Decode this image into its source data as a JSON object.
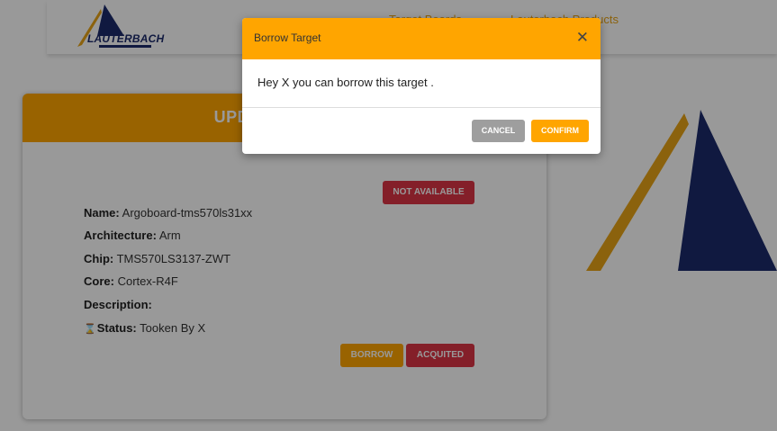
{
  "brand": {
    "name": "LAUTERBACH"
  },
  "nav": {
    "link1": "Target Boards",
    "link2": "Lauterbach Products"
  },
  "card": {
    "title": "UPDATE TARGET",
    "status_badge": "NOT AVAILABLE",
    "fields": {
      "name_label": "Name:",
      "name_value": "Argoboard-tms570ls31xx",
      "arch_label": "Architecture:",
      "arch_value": "Arm",
      "chip_label": "Chip:",
      "chip_value": "TMS570LS3137-ZWT",
      "core_label": "Core:",
      "core_value": "Cortex-R4F",
      "desc_label": "Description:",
      "desc_value": "",
      "status_label": "Status:",
      "status_value": "Tooken By X"
    },
    "status_icon": "⌛",
    "borrow_label": "BORROW",
    "acquired_label": "ACQUITED"
  },
  "modal": {
    "title": "Borrow Target",
    "close_glyph": "✕",
    "message": "Hey X you can borrow this target .",
    "cancel_label": "CANCEL",
    "confirm_label": "CONFIRM"
  },
  "colors": {
    "accent": "#ffa500",
    "danger": "#dc3545",
    "cancel": "#9e9e9e",
    "brand_navy": "#1b2a6b",
    "overlay": "rgba(0,0,0,0.4)"
  }
}
